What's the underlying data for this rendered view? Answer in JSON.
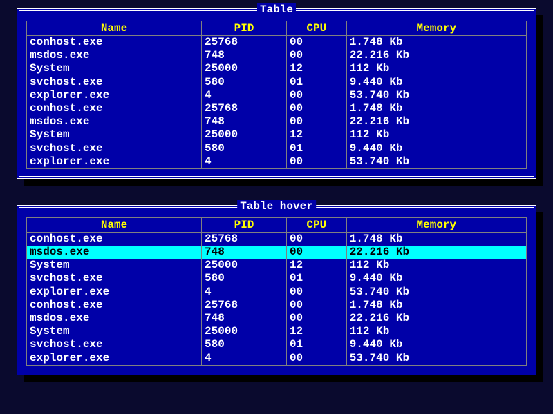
{
  "panels": [
    {
      "title": "Table",
      "hoverIndex": -1
    },
    {
      "title": "Table hover",
      "hoverIndex": 1
    }
  ],
  "columns": [
    "Name",
    "PID",
    "CPU",
    "Memory"
  ],
  "rows": [
    {
      "name": "conhost.exe",
      "pid": "25768",
      "cpu": "00",
      "memory": "1.748 Kb"
    },
    {
      "name": "msdos.exe",
      "pid": "748",
      "cpu": "00",
      "memory": "22.216 Kb"
    },
    {
      "name": "System",
      "pid": "25000",
      "cpu": "12",
      "memory": "112 Kb"
    },
    {
      "name": "svchost.exe",
      "pid": "580",
      "cpu": "01",
      "memory": "9.440 Kb"
    },
    {
      "name": "explorer.exe",
      "pid": "4",
      "cpu": "00",
      "memory": "53.740 Kb"
    },
    {
      "name": "conhost.exe",
      "pid": "25768",
      "cpu": "00",
      "memory": "1.748 Kb"
    },
    {
      "name": "msdos.exe",
      "pid": "748",
      "cpu": "00",
      "memory": "22.216 Kb"
    },
    {
      "name": "System",
      "pid": "25000",
      "cpu": "12",
      "memory": "112 Kb"
    },
    {
      "name": "svchost.exe",
      "pid": "580",
      "cpu": "01",
      "memory": "9.440 Kb"
    },
    {
      "name": "explorer.exe",
      "pid": "4",
      "cpu": "00",
      "memory": "53.740 Kb"
    }
  ]
}
